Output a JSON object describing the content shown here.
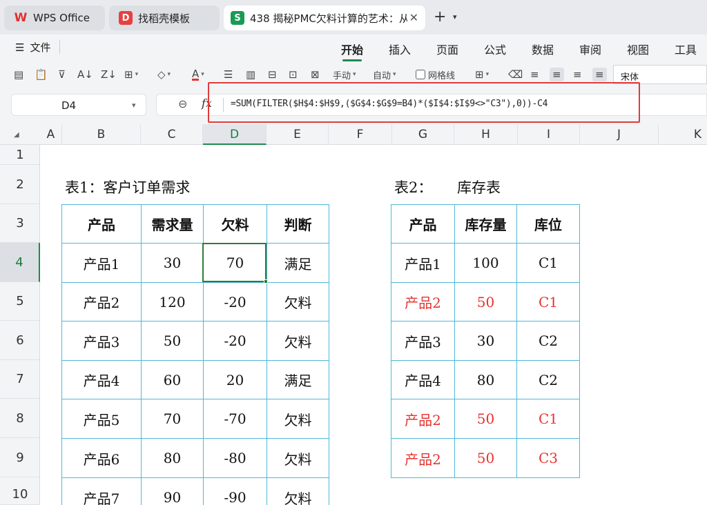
{
  "tabs": [
    {
      "icon": "wps-logo-icon",
      "label": "WPS Office"
    },
    {
      "icon": "template-icon",
      "label": "找稻壳模板"
    },
    {
      "icon": "spreadsheet-icon",
      "label": "438 揭秘PMC欠料计算的艺术：从",
      "active": true
    }
  ],
  "menu": {
    "file_label": "文件",
    "items": [
      "开始",
      "插入",
      "页面",
      "公式",
      "数据",
      "审阅",
      "视图",
      "工具"
    ],
    "active": "开始"
  },
  "toolbar": {
    "manual_label": "手动",
    "auto_label": "自动",
    "gridlines_label": "网格线",
    "font_name": "宋体"
  },
  "formula_bar": {
    "cell_ref": "D4",
    "formula": "=SUM(FILTER($H$4:$H$9,($G$4:$G$9=B4)*($I$4:$I$9<>\"C3\"),0))-C4"
  },
  "columns": [
    "A",
    "B",
    "C",
    "D",
    "E",
    "F",
    "G",
    "H",
    "I",
    "J",
    "K"
  ],
  "rows": [
    "1",
    "2",
    "3",
    "4",
    "5",
    "6",
    "7",
    "8",
    "9",
    "10"
  ],
  "selected_cell": {
    "column": "D",
    "row": "4"
  },
  "sheet": {
    "table1": {
      "caption": "表1：客户订单需求",
      "headers": [
        "产品",
        "需求量",
        "欠料",
        "判断"
      ],
      "rows": [
        [
          "产品1",
          "30",
          "70",
          "满足"
        ],
        [
          "产品2",
          "120",
          "-20",
          "欠料"
        ],
        [
          "产品3",
          "50",
          "-20",
          "欠料"
        ],
        [
          "产品4",
          "60",
          "20",
          "满足"
        ],
        [
          "产品5",
          "70",
          "-70",
          "欠料"
        ],
        [
          "产品6",
          "80",
          "-80",
          "欠料"
        ],
        [
          "产品7",
          "90",
          "-90",
          "欠料"
        ]
      ]
    },
    "table2": {
      "caption_prefix": "表2：",
      "caption_title": "库存表",
      "headers": [
        "产品",
        "库存量",
        "库位"
      ],
      "rows": [
        [
          "产品1",
          "100",
          "C1"
        ],
        [
          "产品2",
          "50",
          "C1"
        ],
        [
          "产品3",
          "30",
          "C2"
        ],
        [
          "产品4",
          "80",
          "C2"
        ],
        [
          "产品2",
          "50",
          "C1"
        ],
        [
          "产品2",
          "50",
          "C3"
        ]
      ],
      "highlight_rows": [
        1,
        4,
        5
      ],
      "highlight_color": "#e8312e"
    }
  },
  "colors": {
    "accent": "#1e8a4c",
    "annotation": "#e03a3a",
    "table_border": "#4fb7d9"
  }
}
